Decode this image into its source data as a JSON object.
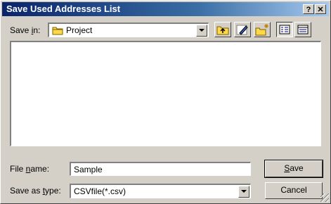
{
  "window": {
    "title": "Save Used Addresses List",
    "help_button": "?",
    "close_button": "✕"
  },
  "toolbar": {
    "save_in_label_prefix": "Save ",
    "save_in_label_accel": "i",
    "save_in_label_suffix": "n:",
    "save_in_value": "Project"
  },
  "form": {
    "file_name_label_prefix": "File ",
    "file_name_label_accel": "n",
    "file_name_label_suffix": "ame:",
    "file_name_value": "Sample",
    "save_type_label_prefix": "Save as ",
    "save_type_label_accel": "t",
    "save_type_label_suffix": "ype:",
    "save_type_value": "CSVfile(*.csv)"
  },
  "buttons": {
    "save_accel": "S",
    "save_rest": "ave",
    "cancel": "Cancel"
  },
  "colors": {
    "title_start": "#0a246a",
    "title_end": "#a6caf0",
    "face": "#d4d0c8"
  }
}
